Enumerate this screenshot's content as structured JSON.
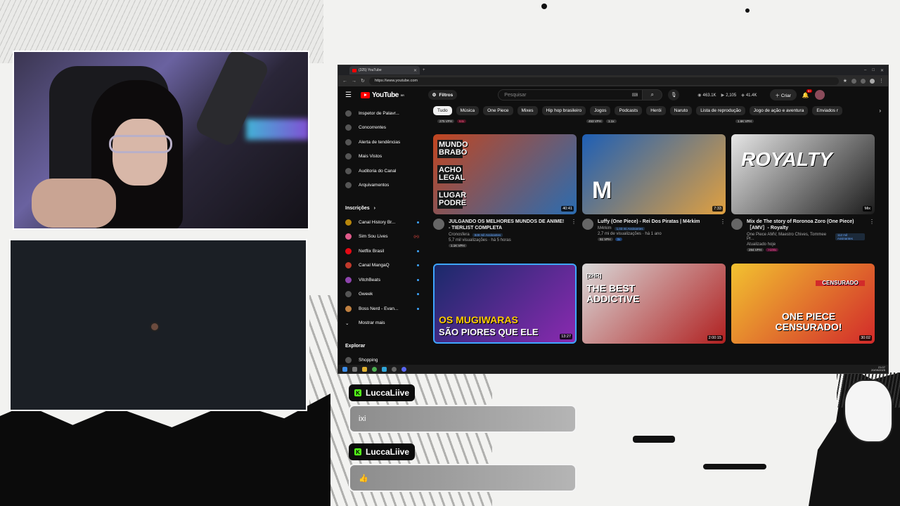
{
  "browser": {
    "tab_title": "(325) YouTube",
    "url": "https://www.youtube.com"
  },
  "youtube": {
    "logo_text": "YouTube",
    "country_code": "BR",
    "filters_label": "Filtros",
    "search_placeholder": "Pesquisar",
    "stats": [
      "463.1K",
      "2,105",
      "41.4K"
    ],
    "create_label": "Criar",
    "notifications_badge": "9+",
    "sidebar_tools": [
      "Inspetor de Palavr...",
      "Concorrentes",
      "Alerta de tendências",
      "Mais Vistos",
      "Auditoria do Canal",
      "Arquivamentos"
    ],
    "subscriptions_title": "Inscrições",
    "subscriptions": [
      {
        "name": "Canal History Br...",
        "status": "dot"
      },
      {
        "name": "Sim Sou Lives",
        "status": "live"
      },
      {
        "name": "Netflix Brasil",
        "status": "dot"
      },
      {
        "name": "Canal MangaQ",
        "status": "dot"
      },
      {
        "name": "VitchBeats",
        "status": "dot"
      },
      {
        "name": "Gweek",
        "status": "dot"
      },
      {
        "name": "Boss Nerd - Evan...",
        "status": "dot"
      }
    ],
    "show_more": "Mostrar mais",
    "explore_title": "Explorar",
    "explore_items": [
      "Shopping"
    ],
    "chips": [
      "Tudo",
      "Música",
      "One Piece",
      "Mixes",
      "Hip hop brasileiro",
      "Jogos",
      "Podcasts",
      "Herói",
      "Naruto",
      "Lista de reprodução",
      "Jogo de ação e aventura",
      "Enviados r"
    ],
    "prev_row_vph": [
      {
        "vph": "275 VPH",
        "badge": "64x"
      },
      {
        "vph": "453 VPH",
        "badge": "1.1x"
      },
      {
        "vph": "1.6K VPH",
        "badge": ""
      }
    ],
    "videos": [
      {
        "title": "JULGANDO OS MELHORES MUNDOS DE ANIME! - TIERLIST COMPLETA",
        "channel": "Cronosfera",
        "subs": "849 mil Assinantes",
        "views": "5,7 mil visualizações · há 5 horas",
        "vph": "1.1K VPH",
        "vph_tag": "",
        "duration": "40:41",
        "thumb_text": [
          "MUNDO BRABO",
          "ACHO LEGAL",
          "LUGAR PODRE"
        ],
        "colors": [
          "#c2451f",
          "#2b6cb0"
        ]
      },
      {
        "title": "Luffy (One Piece) - Rei Dos Piratas | M4rkim",
        "channel": "M4rkim",
        "subs": "1,03 mi Assinantes",
        "views": "2,7 mi de visualizações · há 1 ano",
        "vph": "51 VPH",
        "vph_tag": "3x",
        "duration": "7:33",
        "thumb_text": [
          "M"
        ],
        "colors": [
          "#1e5fb5",
          "#e0a040"
        ]
      },
      {
        "title": "Mix de The story of Roronoa Zoro  (One Piece) ［AMV］- Royalty",
        "channel": "One Piece AMV, Maestro Chives, Tommee Pr...",
        "subs": "112 mil Assinantes",
        "views": "Atualizado hoje",
        "vph": "294 VPH",
        "vph_tag": ">100x",
        "duration": "Mix",
        "thumb_text": [
          "ROYALTY"
        ],
        "colors": [
          "#e6e6e6",
          "#1c1c1c"
        ]
      },
      {
        "title": "",
        "channel": "",
        "subs": "",
        "views": "",
        "vph": "",
        "vph_tag": "",
        "duration": "13:27",
        "thumb_text": [
          "OS MUGIWARAS",
          "SÃO PIORES QUE ELE"
        ],
        "colors": [
          "#1a2a6a",
          "#8a2ab0"
        ]
      },
      {
        "title": "",
        "channel": "",
        "subs": "",
        "views": "",
        "vph": "",
        "vph_tag": "",
        "duration": "2:00:15",
        "thumb_text": [
          "[2HR]",
          "THE BEST ADDICTIVE"
        ],
        "colors": [
          "#d9d9d9",
          "#b02020"
        ]
      },
      {
        "title": "",
        "channel": "",
        "subs": "",
        "views": "",
        "vph": "",
        "vph_tag": "",
        "duration": "30:02",
        "thumb_text": [
          "CENSURADO",
          "ONE PIECE CENSURADO!"
        ],
        "colors": [
          "#f2c230",
          "#d22a2a"
        ]
      }
    ]
  },
  "taskbar": {
    "time": "21:07",
    "date": "20/09/2025"
  },
  "chat": [
    {
      "user": "LuccaLiive",
      "message": "ixi"
    },
    {
      "user": "LuccaLiive",
      "message": "👍"
    }
  ]
}
